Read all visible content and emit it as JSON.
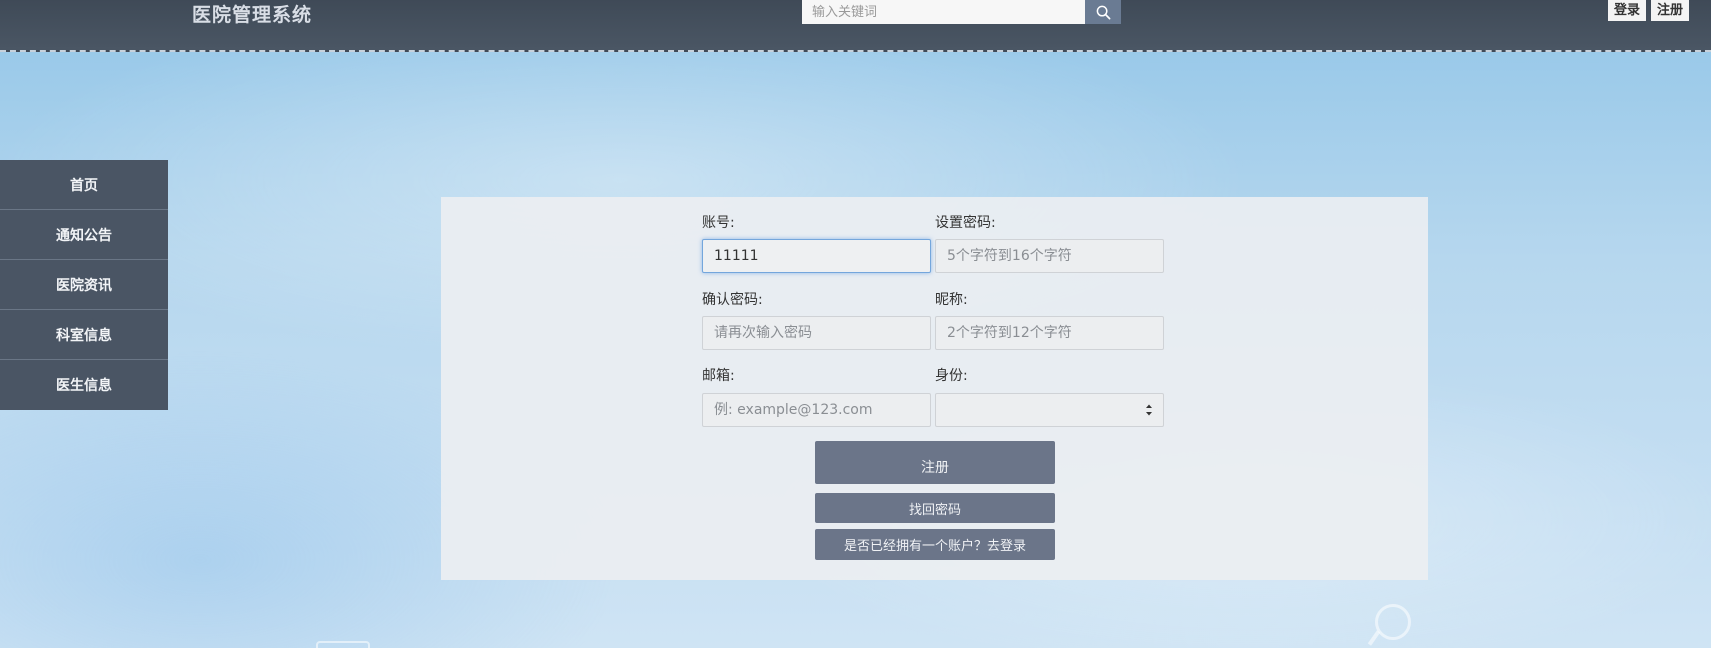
{
  "header": {
    "title": "医院管理系统",
    "search_placeholder": "输入关键词",
    "login_label": "登录",
    "register_label": "注册"
  },
  "sidebar": {
    "items": [
      {
        "label": "首页"
      },
      {
        "label": "通知公告"
      },
      {
        "label": "医院资讯"
      },
      {
        "label": "科室信息"
      },
      {
        "label": "医生信息"
      }
    ]
  },
  "form": {
    "account": {
      "label": "账号:",
      "value": "11111"
    },
    "password": {
      "label": "设置密码:",
      "placeholder": "5个字符到16个字符"
    },
    "confirm_password": {
      "label": "确认密码:",
      "placeholder": "请再次输入密码"
    },
    "nickname": {
      "label": "昵称:",
      "placeholder": "2个字符到12个字符"
    },
    "email": {
      "label": "邮箱:",
      "placeholder": "例: example@123.com"
    },
    "identity": {
      "label": "身份:",
      "value": ""
    },
    "register_button": "注册",
    "recover_button": "找回密码",
    "login_link_button": "是否已经拥有一个账户？去登录"
  },
  "colors": {
    "header_bg": "#434e5b",
    "sidebar_bg": "#4a5564",
    "button_bg": "#6b7589",
    "focus_border": "#74a6dc"
  }
}
